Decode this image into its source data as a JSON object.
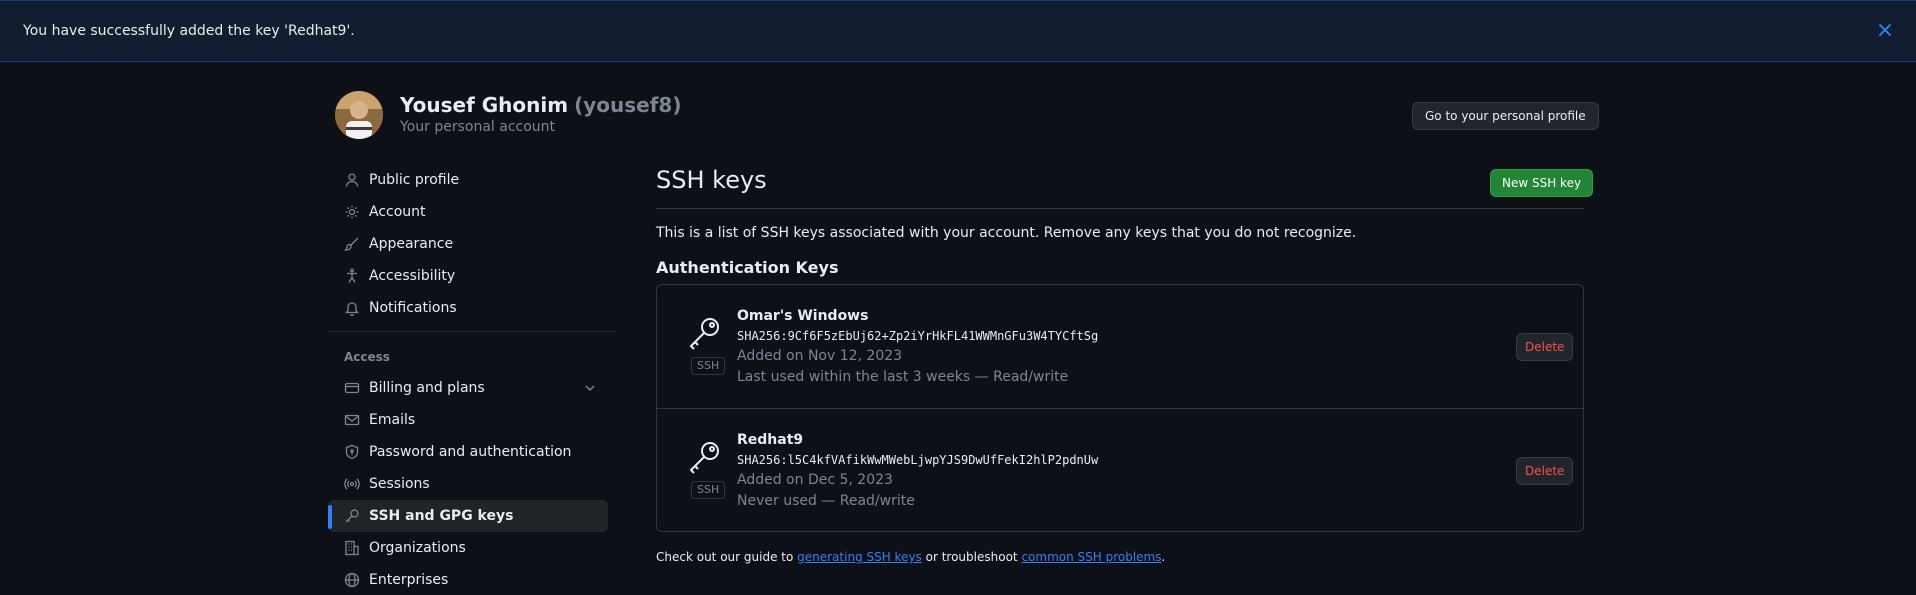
{
  "flash": {
    "message": "You have successfully added the key 'Redhat9'."
  },
  "header": {
    "name": "Yousef Ghonim",
    "handle": "(yousef8)",
    "subtitle": "Your personal account",
    "profile_button": "Go to your personal profile"
  },
  "sidebar": {
    "items": [
      {
        "label": "Public profile",
        "icon": "person-icon"
      },
      {
        "label": "Account",
        "icon": "gear-icon"
      },
      {
        "label": "Appearance",
        "icon": "paintbrush-icon"
      },
      {
        "label": "Accessibility",
        "icon": "accessibility-icon"
      },
      {
        "label": "Notifications",
        "icon": "bell-icon"
      }
    ],
    "section_label": "Access",
    "access_items": [
      {
        "label": "Billing and plans",
        "icon": "credit-card-icon"
      },
      {
        "label": "Emails",
        "icon": "mail-icon"
      },
      {
        "label": "Password and authentication",
        "icon": "shield-lock-icon"
      },
      {
        "label": "Sessions",
        "icon": "broadcast-icon"
      },
      {
        "label": "SSH and GPG keys",
        "icon": "key-icon",
        "active": true
      },
      {
        "label": "Organizations",
        "icon": "organization-icon"
      },
      {
        "label": "Enterprises",
        "icon": "globe-icon"
      }
    ]
  },
  "main": {
    "title": "SSH keys",
    "new_button": "New SSH key",
    "description": "This is a list of SSH keys associated with your account. Remove any keys that you do not recognize.",
    "section_title": "Authentication Keys",
    "keys": [
      {
        "title": "Omar's Windows",
        "fingerprint": "SHA256:9Cf6F5zEbUj62+Zp2iYrHkFL41WWMnGFu3W4TYCftSg",
        "added": "Added on Nov 12, 2023",
        "last_used": "Last used within the last 3 weeks — Read/write",
        "type": "SSH",
        "delete_label": "Delete"
      },
      {
        "title": "Redhat9",
        "fingerprint": "SHA256:l5C4kfVAfikWwMWebLjwpYJS9DwUfFekI2hlP2pdnUw",
        "added": "Added on Dec 5, 2023",
        "last_used": "Never used — Read/write",
        "type": "SSH",
        "delete_label": "Delete"
      }
    ],
    "footer": {
      "prefix": "Check out our guide to ",
      "link1": "generating SSH keys",
      "middle": " or troubleshoot ",
      "link2": "common SSH problems",
      "suffix": "."
    }
  },
  "colors": {
    "background": "#0d1117",
    "accent": "#2f81f7",
    "primary_button": "#238636",
    "danger": "#f85149"
  }
}
